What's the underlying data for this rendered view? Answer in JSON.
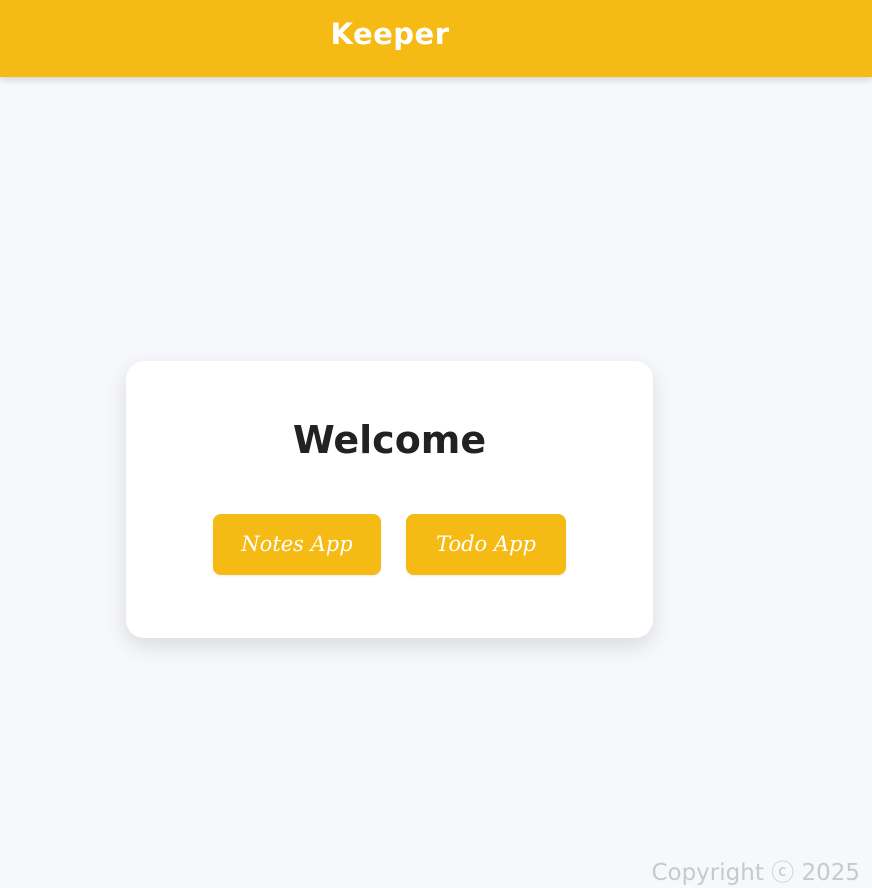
{
  "header": {
    "title": "Keeper",
    "background_color": "#f5ba13"
  },
  "main": {
    "title": "Welcome",
    "buttons": [
      {
        "label": "Notes App"
      },
      {
        "label": "Todo App"
      }
    ]
  },
  "footer": {
    "text": "Copyright ⓒ 2025"
  },
  "colors": {
    "page_background": "#f7f8fc",
    "card_background": "#ffffff",
    "heading_text": "#222222",
    "footer_text": "#c7c9cd",
    "button_background": "#f5ba13",
    "button_text": "#ffffff"
  }
}
